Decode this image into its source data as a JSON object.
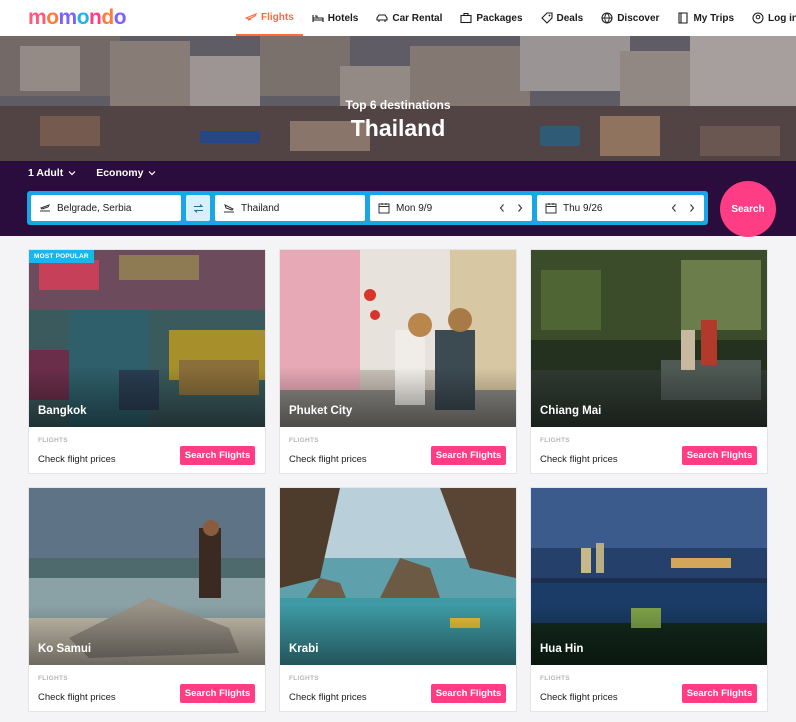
{
  "brand": {
    "logo_letters": [
      "m",
      "o",
      "m",
      "o",
      "n",
      "d",
      "o"
    ]
  },
  "nav": {
    "items": [
      {
        "label": "Flights",
        "icon": "plane-icon",
        "active": true
      },
      {
        "label": "Hotels",
        "icon": "bed-icon",
        "active": false
      },
      {
        "label": "Car Rental",
        "icon": "car-icon",
        "active": false
      },
      {
        "label": "Packages",
        "icon": "suitcase-icon",
        "active": false
      },
      {
        "label": "Deals",
        "icon": "tag-icon",
        "active": false
      },
      {
        "label": "Discover",
        "icon": "globe-icon",
        "active": false
      },
      {
        "label": "My Trips",
        "icon": "book-icon",
        "active": false
      },
      {
        "label": "Log in",
        "icon": "user-icon",
        "active": false
      }
    ]
  },
  "hero": {
    "subtitle": "Top 6 destinations",
    "title": "Thailand"
  },
  "search": {
    "travelers": "1 Adult",
    "cabin": "Economy",
    "origin": "Belgrade, Serbia",
    "destination": "Thailand",
    "depart": "Mon 9/9",
    "return": "Thu 9/26",
    "button": "Search"
  },
  "cards": [
    {
      "city": "Bangkok",
      "kind": "FLIGHTS",
      "text": "Check flight prices",
      "button": "Search Flights",
      "badge": "MOST POPULAR"
    },
    {
      "city": "Phuket City",
      "kind": "FLIGHTS",
      "text": "Check flight prices",
      "button": "Search Flights"
    },
    {
      "city": "Chiang Mai",
      "kind": "FLIGHTS",
      "text": "Check flight prices",
      "button": "Search Flights"
    },
    {
      "city": "Ko Samui",
      "kind": "FLIGHTS",
      "text": "Check flight prices",
      "button": "Search Flights"
    },
    {
      "city": "Krabi",
      "kind": "FLIGHTS",
      "text": "Check flight prices",
      "button": "Search Flights"
    },
    {
      "city": "Hua Hin",
      "kind": "FLIGHTS",
      "text": "Check flight prices",
      "button": "Search Flights"
    }
  ],
  "colors": {
    "accent_pink": "#ff3d84",
    "nav_active": "#ff6b3d",
    "search_bar": "#18a6e6",
    "panel_bg": "#2b0d3d"
  }
}
